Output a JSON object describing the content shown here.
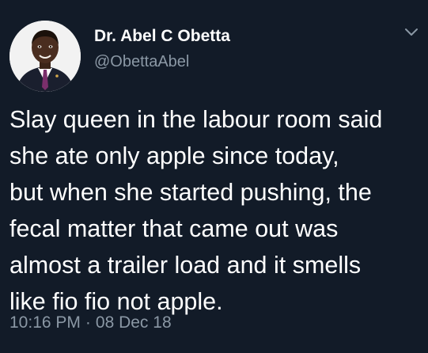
{
  "colors": {
    "background": "#121b28",
    "primary_text": "#ffffff",
    "secondary_text": "#8b98a5"
  },
  "author": {
    "display_name": "Dr. Abel C Obetta",
    "handle": "@ObettaAbel",
    "avatar_icon": "user-avatar-icon"
  },
  "menu": {
    "icon": "chevron-down-icon"
  },
  "tweet": {
    "lines": [
      "Slay queen in the labour room said",
      "she ate only apple since today,",
      "but when she started pushing, the",
      "fecal matter that came out was",
      "almost a trailer load and it smells",
      "like fio fio not apple."
    ]
  },
  "meta": {
    "time": "10:16 PM",
    "separator": "·",
    "date": "08 Dec 18"
  }
}
